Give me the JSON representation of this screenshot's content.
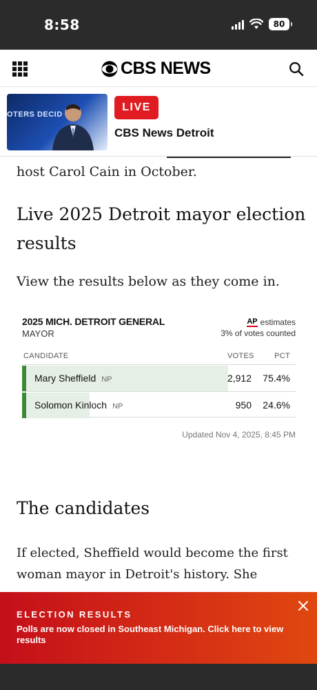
{
  "status_bar": {
    "time": "8:58",
    "battery": "80"
  },
  "header": {
    "brand": "CBS NEWS"
  },
  "live": {
    "badge": "LIVE",
    "channel": "CBS News Detroit",
    "thumb_text": "OTERS DECID"
  },
  "article": {
    "intro_line": "host Carol Cain in October.",
    "heading": "Live 2025 Detroit mayor election results",
    "results_intro": "View the results below as they come in.",
    "candidates_heading": "The candidates",
    "candidates_text": "If elected, Sheffield would become the first woman mayor in Detroit's history. She"
  },
  "results": {
    "title": "2025 MICH. DETROIT GENERAL",
    "race": "MAYOR",
    "ap_label": "AP",
    "estimates": "estimates",
    "counted": "3% of votes counted",
    "columns": {
      "candidate": "CANDIDATE",
      "votes": "VOTES",
      "pct": "PCT"
    },
    "rows": [
      {
        "name": "Mary Sheffield",
        "party": "NP",
        "votes": "2,912",
        "pct": "75.4%",
        "share": 0.754
      },
      {
        "name": "Solomon Kinloch",
        "party": "NP",
        "votes": "950",
        "pct": "24.6%",
        "share": 0.246
      }
    ],
    "updated": "Updated Nov 4, 2025, 8:45 PM"
  },
  "banner": {
    "kicker": "ELECTION RESULTS",
    "message": "Polls are now closed in Southeast Michigan. Click here to view results"
  },
  "colors": {
    "accent_red": "#e01b22",
    "winner_green": "#3c8a37",
    "bar_fill": "#e6efe5"
  }
}
